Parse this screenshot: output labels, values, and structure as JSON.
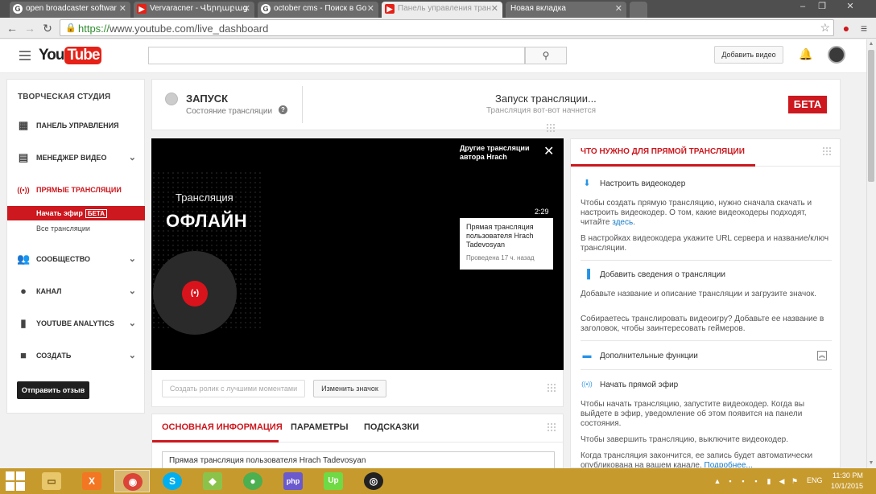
{
  "browser": {
    "tabs": [
      {
        "label": "open broadcaster softwar",
        "icon": "google-icon"
      },
      {
        "label": "Vervaracner - Վերդաբաց",
        "icon": "youtube-icon"
      },
      {
        "label": "october cms - Поиск в Go",
        "icon": "google-icon"
      },
      {
        "label": "Панель управления тран",
        "icon": "youtube-icon"
      },
      {
        "label": "Новая вкладка",
        "icon": "none"
      }
    ],
    "active_tab_index": 3,
    "url_scheme": "https://",
    "url_rest": "www.youtube.com/live_dashboard"
  },
  "header": {
    "logo_you": "You",
    "logo_tube": "Tube",
    "search_value": "",
    "upload_label": "Добавить видео"
  },
  "sidebar": {
    "title": "ТВОРЧЕСКАЯ СТУДИЯ",
    "items": [
      {
        "label": "ПАНЕЛЬ УПРАВЛЕНИЯ",
        "icon": "dashboard-icon",
        "chevron": false
      },
      {
        "label": "МЕНЕДЖЕР ВИДЕО",
        "icon": "video-manager-icon",
        "chevron": true
      },
      {
        "label": "ПРЯМЫЕ ТРАНСЛЯЦИИ",
        "icon": "live-broadcast-icon",
        "chevron": false
      },
      {
        "label": "СООБЩЕСТВО",
        "icon": "community-icon",
        "chevron": true
      },
      {
        "label": "КАНАЛ",
        "icon": "channel-icon",
        "chevron": true
      },
      {
        "label": "YOUTUBE ANALYTICS",
        "icon": "analytics-icon",
        "chevron": true
      },
      {
        "label": "СОЗДАТЬ",
        "icon": "create-icon",
        "chevron": true
      }
    ],
    "sub_active": "Начать эфир",
    "sub_active_badge": "БЕТА",
    "sub_all": "Все трансляции",
    "feedback": "Отправить отзыв"
  },
  "status": {
    "label": "ЗАПУСК",
    "sub": "Состояние трансляции",
    "launch_title": "Запуск трансляции...",
    "launch_sub": "Трансляция вот-вот начнется",
    "beta": "БЕТА"
  },
  "player": {
    "label": "Трансляция",
    "offline": "ОФЛАЙН",
    "other_streams": "Другие трансляции автора Hrach",
    "duration": "2:29",
    "card_title": "Прямая трансляция пользователя Hrach Tadevosyan",
    "card_meta": "Проведена 17 ч. назад",
    "rec_symbol": "(•)"
  },
  "controls": {
    "highlights": "Создать ролик с лучшими моментами",
    "change_thumb": "Изменить значок"
  },
  "info": {
    "tabs": [
      "ОСНОВНАЯ ИНФОРМАЦИЯ",
      "ПАРАМЕТРЫ",
      "ПОДСКАЗКИ"
    ],
    "title_value": "Прямая трансляция пользователя Hrach Tadevosyan"
  },
  "rightpanel": {
    "title": "ЧТО НУЖНО ДЛЯ ПРЯМОЙ ТРАНСЛЯЦИИ",
    "s1_title": "Настроить видеокодер",
    "s1_p1": "Чтобы создать прямую трансляцию, нужно сначала скачать и настроить видеокодер. О том, какие видеокодеры подходят, читайте",
    "s1_link": "здесь",
    "s1_p2": "В настройках видеокодера укажите URL сервера и название/ключ трансляции.",
    "s2_title": "Добавить сведения о трансляции",
    "s2_p1": "Добавьте название и описание трансляции и загрузите значок.",
    "s2_p2": "Собираетесь транслировать видеоигру? Добавьте ее название в заголовок, чтобы заинтересовать геймеров.",
    "s3_title": "Дополнительные функции",
    "s4_title": "Начать прямой эфир",
    "s4_p1": "Чтобы начать трансляцию, запустите видеокодер. Когда вы выйдете в эфир, уведомление об этом появится на панели состояния.",
    "s4_p2": "Чтобы завершить трансляцию, выключите видеокодер.",
    "s4_p3": "Когда трансляция закончится, ее запись будет автоматически опубликована на вашем канале.",
    "s4_link": "Подробнее..."
  },
  "taskbar": {
    "apps": [
      "file-explorer-icon",
      "xampp-icon",
      "chrome-icon",
      "skype-icon",
      "app-icon",
      "app-icon",
      "php-icon",
      "upwork-icon",
      "obs-icon"
    ],
    "lang": "ENG",
    "time": "11:30 PM",
    "date": "10/1/2015"
  },
  "colors": {
    "youtube_red": "#cc181e",
    "taskbar": "#c79a2e",
    "link_blue": "#167ac6"
  }
}
